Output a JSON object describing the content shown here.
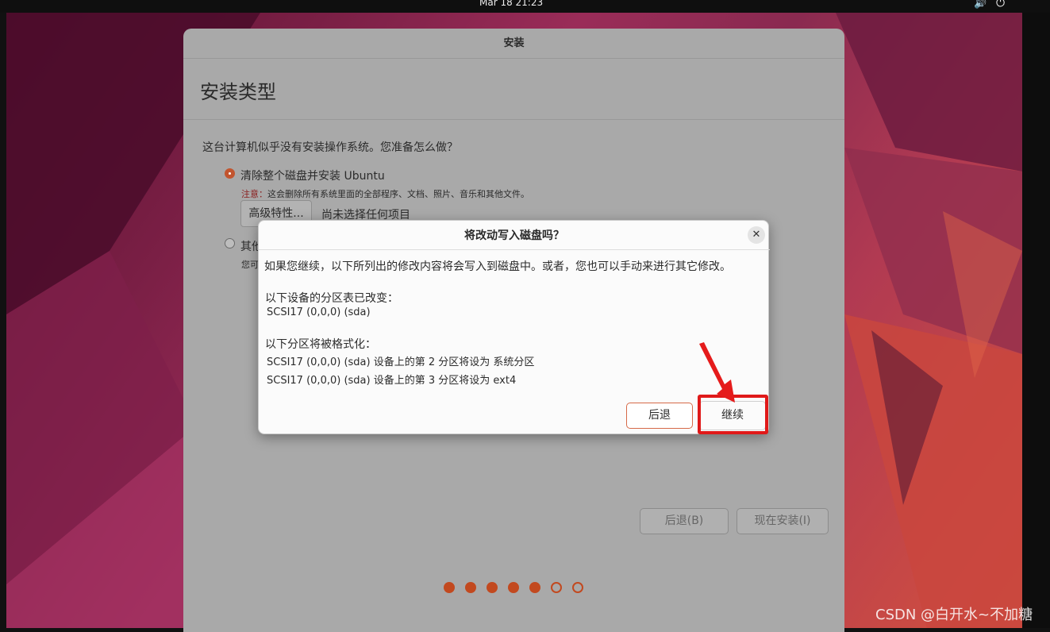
{
  "topbar": {
    "clock": "Mar 18  21:23",
    "sound_icon": "🔊",
    "power_icon": "⏻"
  },
  "installer": {
    "window_title": "安装",
    "heading": "安装类型",
    "question": "这台计算机似乎没有安装操作系统。您准备怎么做？",
    "option_erase": {
      "label": "清除整个磁盘并安装 Ubuntu",
      "selected": true,
      "warning_prefix": "注意：",
      "warning_text": "这会删除所有系统里面的全部程序、文档、照片、音乐和其他文件。",
      "advanced_button": "高级特性...",
      "advanced_status": "尚未选择任何项目"
    },
    "option_other": {
      "label": "其他",
      "desc": "您可",
      "selected": false
    },
    "back_button": "后退(B)",
    "install_button": "现在安装(I)",
    "progress": {
      "total": 7,
      "completed": 5
    }
  },
  "dialog": {
    "title": "将改动写入磁盘吗？",
    "close_icon": "✕",
    "intro": "如果您继续，以下所列出的修改内容将会写入到磁盘中。或者，您也可以手动来进行其它修改。",
    "changed_heading": "以下设备的分区表已改变：",
    "changed_items": [
      "SCSI17 (0,0,0) (sda)"
    ],
    "format_heading": "以下分区将被格式化：",
    "format_items": [
      "SCSI17 (0,0,0) (sda) 设备上的第 2 分区将设为 系统分区",
      "SCSI17 (0,0,0) (sda) 设备上的第 3 分区将设为 ext4"
    ],
    "back_button": "后退",
    "continue_button": "继续"
  },
  "watermark": "CSDN @白开水~不加糖",
  "colors": {
    "accent": "#c2491f",
    "highlight": "#e01919"
  }
}
